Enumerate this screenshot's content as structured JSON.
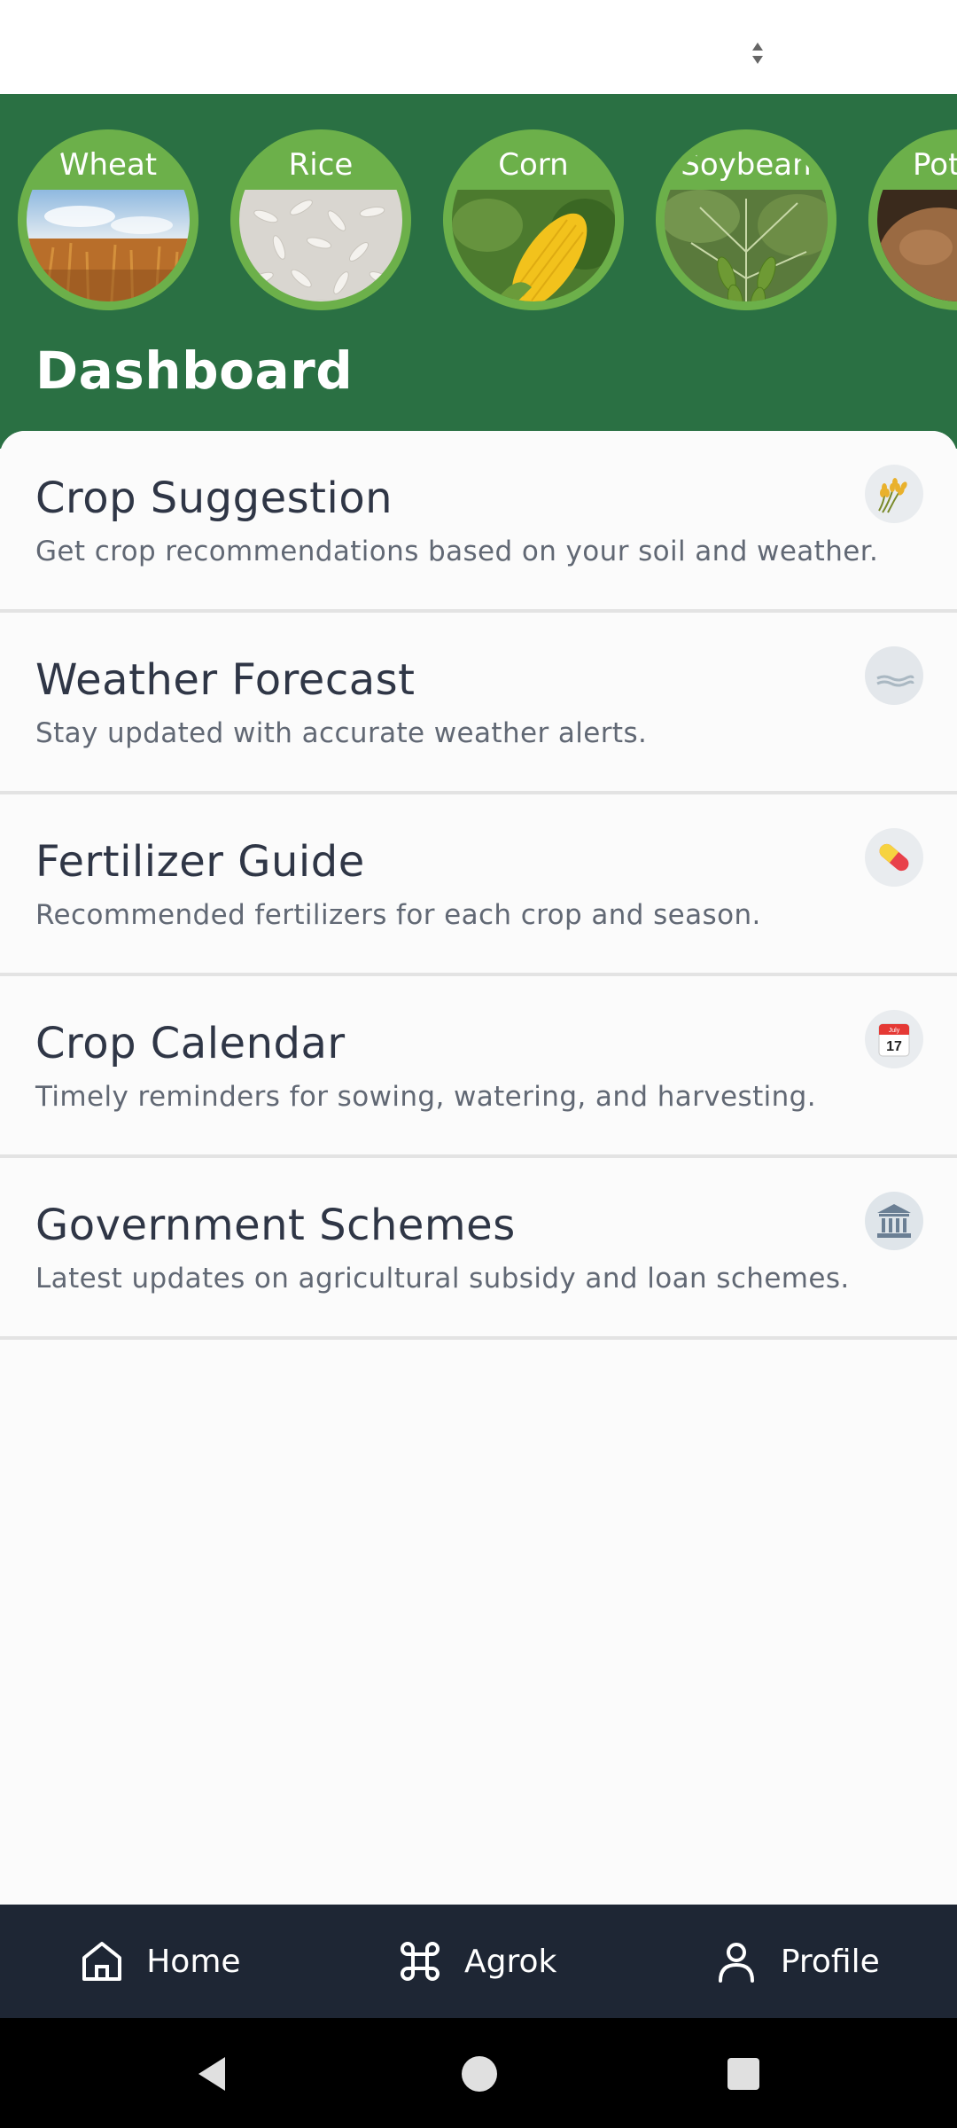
{
  "crops": [
    {
      "label": "Wheat"
    },
    {
      "label": "Rice"
    },
    {
      "label": "Corn"
    },
    {
      "label": "Soybean"
    },
    {
      "label": "Pota"
    }
  ],
  "dashboard": {
    "title": "Dashboard"
  },
  "cards": [
    {
      "title": "Crop Suggestion",
      "description": "Get crop recommendations based on your soil and weather.",
      "icon": "wheat-sheaf-icon"
    },
    {
      "title": "Weather Forecast",
      "description": "Stay updated with accurate weather alerts.",
      "icon": "fog-icon"
    },
    {
      "title": "Fertilizer Guide",
      "description": "Recommended fertilizers for each crop and season.",
      "icon": "pill-icon"
    },
    {
      "title": "Crop Calendar",
      "description": "Timely reminders for sowing, watering, and harvesting.",
      "icon": "calendar-icon",
      "calendar_month": "July",
      "calendar_day": "17"
    },
    {
      "title": "Government Schemes",
      "description": "Latest updates on agricultural subsidy and loan schemes.",
      "icon": "government-building-icon"
    }
  ],
  "bottom_nav": [
    {
      "label": "Home",
      "icon": "home-icon"
    },
    {
      "label": "Agrok",
      "icon": "command-icon"
    },
    {
      "label": "Profile",
      "icon": "user-icon"
    }
  ],
  "colors": {
    "header_green": "#2a7043",
    "crop_ring": "#6cb04a",
    "nav_dark": "#1e2634"
  }
}
